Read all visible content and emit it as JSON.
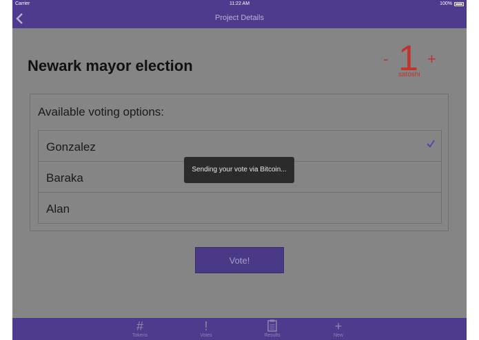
{
  "status_bar": {
    "carrier": "Carrier",
    "time": "11:22 AM",
    "battery": "100%"
  },
  "nav": {
    "title": "Project Details",
    "back_icon": "chevron-left-icon"
  },
  "project": {
    "title": "Newark mayor election"
  },
  "amount": {
    "minus": "-",
    "value": "1",
    "plus": "+",
    "unit": "satoshi"
  },
  "voting": {
    "label": "Available voting options:",
    "options": [
      "Gonzalez",
      "Baraka",
      "Alan"
    ],
    "selected": "Gonzalez"
  },
  "vote_button": "Vote!",
  "toast": "Sending your vote via Bitcoin...",
  "tabs": [
    {
      "label": "Tokens",
      "icon": "#"
    },
    {
      "label": "Votes",
      "icon": "!"
    },
    {
      "label": "Results",
      "icon": "clipboard-icon"
    },
    {
      "label": "New",
      "icon": "+"
    }
  ],
  "colors": {
    "accent": "#4f3b8e",
    "amount": "#c0342d",
    "overlay": "#858585"
  }
}
